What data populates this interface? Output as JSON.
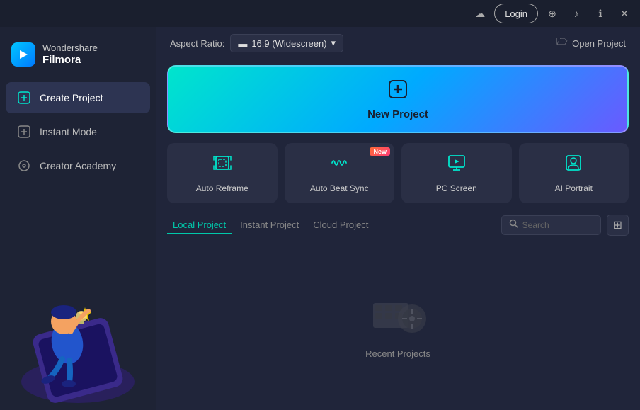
{
  "app": {
    "brand": "Wondershare",
    "product": "Filmora"
  },
  "titlebar": {
    "login_label": "Login",
    "cloud_icon": "☁",
    "download_icon": "⬇",
    "bell_icon": "🔔",
    "info_icon": "ℹ",
    "close_icon": "✕"
  },
  "sidebar": {
    "nav_items": [
      {
        "id": "create-project",
        "label": "Create Project",
        "active": true
      },
      {
        "id": "instant-mode",
        "label": "Instant Mode",
        "active": false
      },
      {
        "id": "creator-academy",
        "label": "Creator Academy",
        "active": false
      }
    ]
  },
  "topbar": {
    "aspect_ratio_label": "Aspect Ratio:",
    "aspect_value": "16:9 (Widescreen)",
    "open_project_label": "Open Project"
  },
  "new_project": {
    "label": "New Project"
  },
  "quick_actions": [
    {
      "id": "auto-reframe",
      "label": "Auto Reframe",
      "new": false
    },
    {
      "id": "auto-beat-sync",
      "label": "Auto Beat Sync",
      "new": true
    },
    {
      "id": "pc-screen",
      "label": "PC Screen",
      "new": false
    },
    {
      "id": "ai-portrait",
      "label": "AI Portrait",
      "new": false
    }
  ],
  "projects": {
    "tabs": [
      {
        "id": "local",
        "label": "Local Project",
        "active": true
      },
      {
        "id": "instant",
        "label": "Instant Project",
        "active": false
      },
      {
        "id": "cloud",
        "label": "Cloud Project",
        "active": false
      }
    ],
    "search_placeholder": "Search",
    "empty_label": "Recent Projects",
    "new_badge_text": "New"
  }
}
